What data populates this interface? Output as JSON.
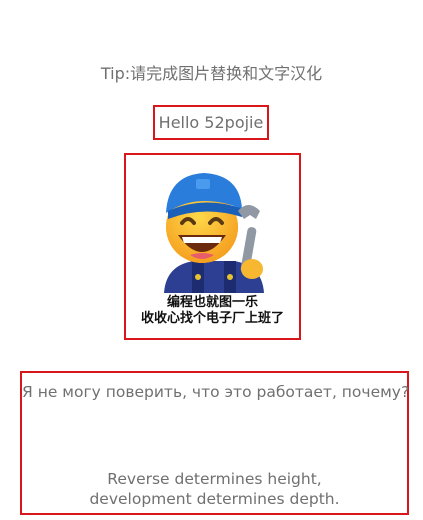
{
  "tip": "Tip:请完成图片替换和文字汉化",
  "hello": "Hello 52pojie",
  "image": {
    "icon": "mechanic-emoji-icon",
    "caption_line1": "编程也就图一乐",
    "caption_line2": "收收心找个电子厂上班了"
  },
  "russian_text": "Я не могу поверить, что это работает, почему?",
  "reverse_line1": "Reverse determines height,",
  "reverse_line2": "development determines depth.",
  "colors": {
    "border": "#d9161c",
    "text": "#707070"
  }
}
